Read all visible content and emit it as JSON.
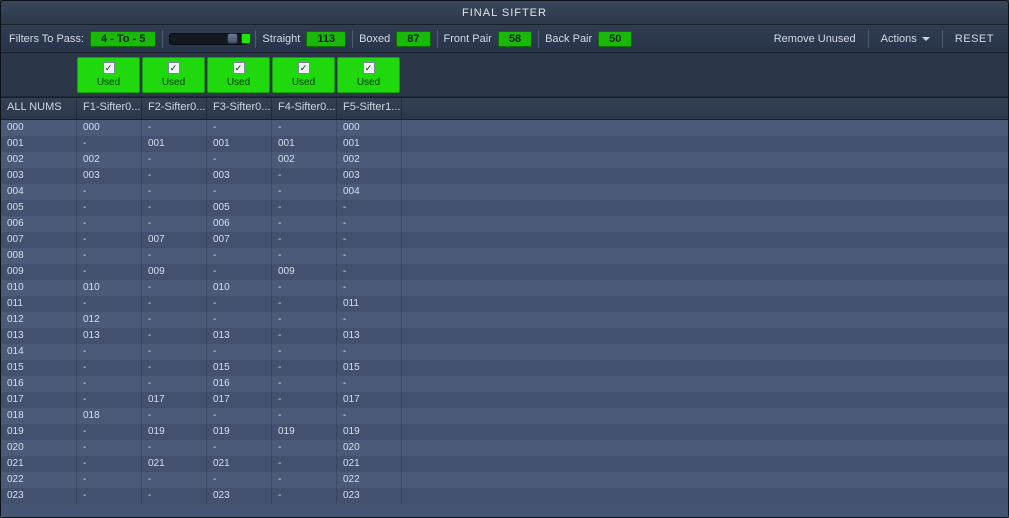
{
  "window_title": "FINAL SIFTER",
  "toolbar": {
    "filters_to_pass_label": "Filters To Pass:",
    "filters_to_pass_value": "4 - To - 5",
    "straight_label": "Straight",
    "straight_value": "113",
    "boxed_label": "Boxed",
    "boxed_value": "87",
    "front_pair_label": "Front Pair",
    "front_pair_value": "58",
    "back_pair_label": "Back Pair",
    "back_pair_value": "50",
    "remove_unused": "Remove Unused",
    "actions": "Actions",
    "reset": "RESET"
  },
  "column_toggles": [
    {
      "checked": true,
      "label": "Used"
    },
    {
      "checked": true,
      "label": "Used"
    },
    {
      "checked": true,
      "label": "Used"
    },
    {
      "checked": true,
      "label": "Used"
    },
    {
      "checked": true,
      "label": "Used"
    }
  ],
  "grid": {
    "headers": [
      "ALL NUMS",
      "F1-Sifter0...",
      "F2-Sifter0...",
      "F3-Sifter0...",
      "F4-Sifter0...",
      "F5-Sifter1..."
    ],
    "rows": [
      [
        "000",
        "000",
        "-",
        "-",
        "-",
        "000"
      ],
      [
        "001",
        "-",
        "001",
        "001",
        "001",
        "001"
      ],
      [
        "002",
        "002",
        "-",
        "-",
        "002",
        "002"
      ],
      [
        "003",
        "003",
        "-",
        "003",
        "-",
        "003"
      ],
      [
        "004",
        "-",
        "-",
        "-",
        "-",
        "004"
      ],
      [
        "005",
        "-",
        "-",
        "005",
        "-",
        "-"
      ],
      [
        "006",
        "-",
        "-",
        "006",
        "-",
        "-"
      ],
      [
        "007",
        "-",
        "007",
        "007",
        "-",
        "-"
      ],
      [
        "008",
        "-",
        "-",
        "-",
        "-",
        "-"
      ],
      [
        "009",
        "-",
        "009",
        "-",
        "009",
        "-"
      ],
      [
        "010",
        "010",
        "-",
        "010",
        "-",
        "-"
      ],
      [
        "011",
        "-",
        "-",
        "-",
        "-",
        "011"
      ],
      [
        "012",
        "012",
        "-",
        "-",
        "-",
        "-"
      ],
      [
        "013",
        "013",
        "-",
        "013",
        "-",
        "013"
      ],
      [
        "014",
        "-",
        "-",
        "-",
        "-",
        "-"
      ],
      [
        "015",
        "-",
        "-",
        "015",
        "-",
        "015"
      ],
      [
        "016",
        "-",
        "-",
        "016",
        "-",
        "-"
      ],
      [
        "017",
        "-",
        "017",
        "017",
        "-",
        "017"
      ],
      [
        "018",
        "018",
        "-",
        "-",
        "-",
        "-"
      ],
      [
        "019",
        "-",
        "019",
        "019",
        "019",
        "019"
      ],
      [
        "020",
        "-",
        "-",
        "-",
        "-",
        "020"
      ],
      [
        "021",
        "-",
        "021",
        "021",
        "-",
        "021"
      ],
      [
        "022",
        "-",
        "-",
        "-",
        "-",
        "022"
      ],
      [
        "023",
        "-",
        "-",
        "023",
        "-",
        "023"
      ]
    ]
  }
}
